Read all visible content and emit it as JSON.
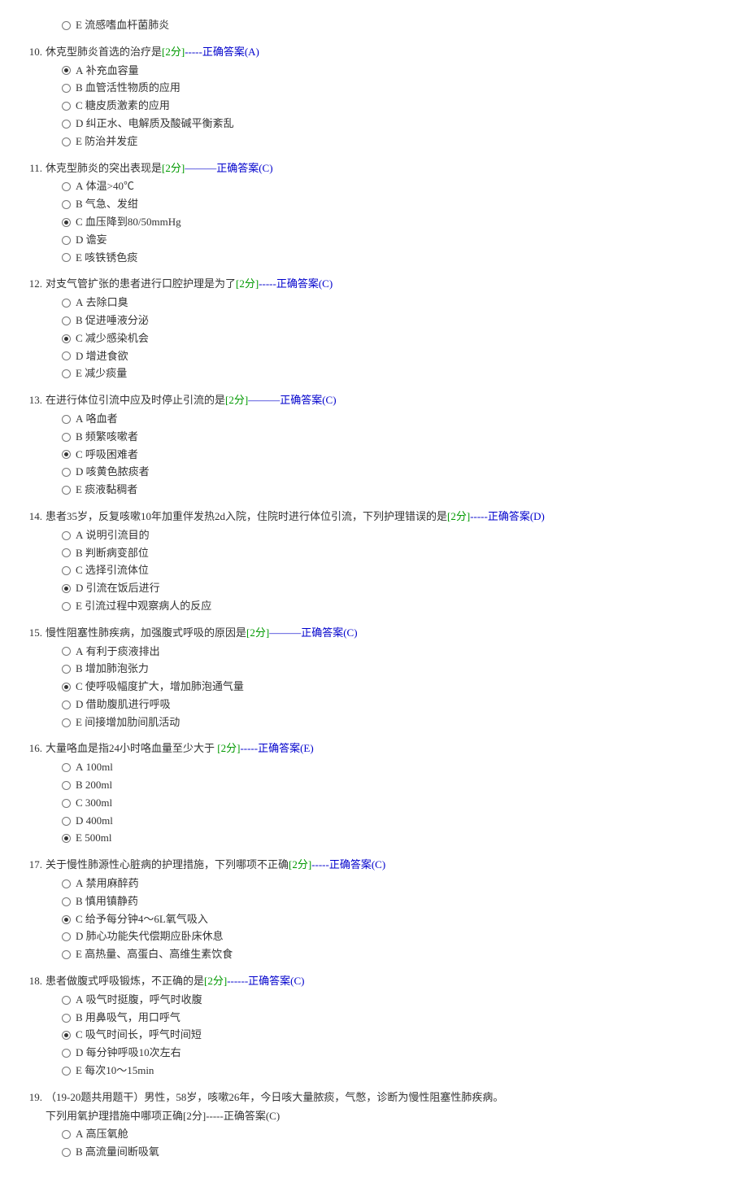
{
  "questions": [
    {
      "num": "",
      "stem": "",
      "score": "",
      "answer": "",
      "options": [
        {
          "letter": "E",
          "text": "流感嗜血杆菌肺炎",
          "selected": false
        }
      ]
    },
    {
      "num": "10.",
      "stem": "休克型肺炎首选的治疗是",
      "score": "[2分]",
      "answer": "-----正确答案(A)",
      "options": [
        {
          "letter": "A",
          "text": "补充血容量",
          "selected": true
        },
        {
          "letter": "B",
          "text": "血管活性物质的应用",
          "selected": false
        },
        {
          "letter": "C",
          "text": "糖皮质激素的应用",
          "selected": false
        },
        {
          "letter": "D",
          "text": "纠正水、电解质及酸碱平衡紊乱",
          "selected": false
        },
        {
          "letter": "E",
          "text": "防治并发症",
          "selected": false
        }
      ]
    },
    {
      "num": "11.",
      "stem": "休克型肺炎的突出表现是",
      "score": "[2分]",
      "answer": "———正确答案(C)",
      "options": [
        {
          "letter": "A",
          "text": "体温>40℃",
          "selected": false
        },
        {
          "letter": "B",
          "text": "气急、发绀",
          "selected": false
        },
        {
          "letter": "C",
          "text": "血压降到80/50mmHg",
          "selected": true
        },
        {
          "letter": "D",
          "text": "谵妄",
          "selected": false
        },
        {
          "letter": "E",
          "text": "咳铁锈色痰",
          "selected": false
        }
      ]
    },
    {
      "num": "12.",
      "stem": "对支气管扩张的患者进行口腔护理是为了",
      "score": "[2分]",
      "answer": "-----正确答案(C)",
      "options": [
        {
          "letter": "A",
          "text": "去除口臭",
          "selected": false
        },
        {
          "letter": "B",
          "text": "促进唾液分泌",
          "selected": false
        },
        {
          "letter": "C",
          "text": "减少感染机会",
          "selected": true
        },
        {
          "letter": "D",
          "text": "增进食欲",
          "selected": false
        },
        {
          "letter": "E",
          "text": "减少痰量",
          "selected": false
        }
      ]
    },
    {
      "num": "13.",
      "stem": "在进行体位引流中应及时停止引流的是",
      "score": "[2分]",
      "answer": "———正确答案(C)",
      "options": [
        {
          "letter": "A",
          "text": "咯血者",
          "selected": false
        },
        {
          "letter": "B",
          "text": "频繁咳嗽者",
          "selected": false
        },
        {
          "letter": "C",
          "text": "呼吸困难者",
          "selected": true
        },
        {
          "letter": "D",
          "text": "咳黄色脓痰者",
          "selected": false
        },
        {
          "letter": "E",
          "text": "痰液黏稠者",
          "selected": false
        }
      ]
    },
    {
      "num": "14.",
      "stem": "患者35岁，反复咳嗽10年加重伴发热2d入院，住院时进行体位引流，下列护理错误的是",
      "score": "[2分]",
      "answer": "-----正确答案(D)",
      "options": [
        {
          "letter": "A",
          "text": "说明引流目的",
          "selected": false
        },
        {
          "letter": "B",
          "text": "判断病变部位",
          "selected": false
        },
        {
          "letter": "C",
          "text": "选择引流体位",
          "selected": false
        },
        {
          "letter": "D",
          "text": "引流在饭后进行",
          "selected": true
        },
        {
          "letter": "E",
          "text": "引流过程中观察病人的反应",
          "selected": false
        }
      ]
    },
    {
      "num": "15.",
      "stem": "慢性阻塞性肺疾病，加强腹式呼吸的原因是",
      "score": "[2分]",
      "answer": "———正确答案(C)",
      "options": [
        {
          "letter": "A",
          "text": "有利于痰液排出",
          "selected": false
        },
        {
          "letter": "B",
          "text": "增加肺泡张力",
          "selected": false
        },
        {
          "letter": "C",
          "text": "使呼吸幅度扩大，增加肺泡通气量",
          "selected": true
        },
        {
          "letter": "D",
          "text": "借助腹肌进行呼吸",
          "selected": false
        },
        {
          "letter": "E",
          "text": "间接增加肋间肌活动",
          "selected": false
        }
      ]
    },
    {
      "num": "16.",
      "stem": "大量咯血是指24小时咯血量至少大于 ",
      "score": "[2分]",
      "answer": "-----正确答案(E)",
      "options": [
        {
          "letter": "A",
          "text": "100ml",
          "selected": false
        },
        {
          "letter": "B",
          "text": "200ml",
          "selected": false
        },
        {
          "letter": "C",
          "text": "300ml",
          "selected": false
        },
        {
          "letter": "D",
          "text": "400ml",
          "selected": false
        },
        {
          "letter": "E",
          "text": "500ml",
          "selected": true
        }
      ]
    },
    {
      "num": "17.",
      "stem": "关于慢性肺源性心脏病的护理措施，下列哪项不正确",
      "score": "[2分]",
      "answer": "-----正确答案(C)",
      "options": [
        {
          "letter": "A",
          "text": "禁用麻醉药",
          "selected": false
        },
        {
          "letter": "B",
          "text": "慎用镇静药",
          "selected": false
        },
        {
          "letter": "C",
          "text": "给予每分钟4～6L氧气吸入",
          "selected": true
        },
        {
          "letter": "D",
          "text": "肺心功能失代偿期应卧床休息",
          "selected": false
        },
        {
          "letter": "E",
          "text": "高热量、高蛋白、高维生素饮食",
          "selected": false
        }
      ]
    },
    {
      "num": "18.",
      "stem": "患者做腹式呼吸锻炼，不正确的是",
      "score": "[2分]",
      "answer": "------正确答案(C)",
      "options": [
        {
          "letter": "A",
          "text": "吸气时挺腹，呼气时收腹",
          "selected": false
        },
        {
          "letter": "B",
          "text": "用鼻吸气，用口呼气",
          "selected": false
        },
        {
          "letter": "C",
          "text": "吸气时间长，呼气时间短",
          "selected": true
        },
        {
          "letter": "D",
          "text": "每分钟呼吸10次左右",
          "selected": false
        },
        {
          "letter": "E",
          "text": "每次10～15min",
          "selected": false
        }
      ]
    },
    {
      "num": "19.",
      "stem": "（19-20题共用题干）男性，58岁，咳嗽26年，今日咳大量脓痰，气憋，诊断为慢性阻塞性肺疾病。",
      "subtext": "下列用氧护理措施中哪项正确",
      "score": "[2分]",
      "answer": "-----正确答案(C)",
      "options": [
        {
          "letter": "A",
          "text": "高压氧舱",
          "selected": false
        },
        {
          "letter": "B",
          "text": "高流量间断吸氧",
          "selected": false
        }
      ]
    }
  ]
}
